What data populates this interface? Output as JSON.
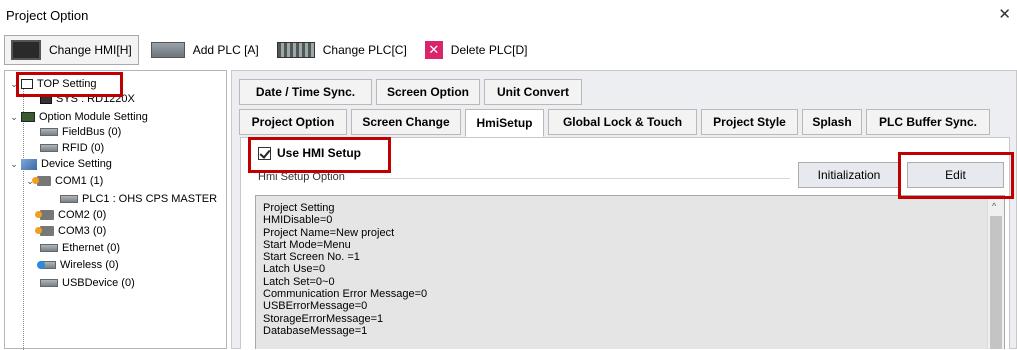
{
  "window": {
    "title": "Project Option",
    "close_glyph": "✕"
  },
  "toolbar": {
    "change_hmi": "Change HMI[H]",
    "add_plc": "Add PLC [A]",
    "change_plc": "Change PLC[C]",
    "delete_plc": "Delete PLC[D]",
    "delete_glyph": "✕"
  },
  "tree": {
    "top_setting": "TOP Setting",
    "sys": "SYS : RD1220X",
    "option_module": "Option Module Setting",
    "fieldbus": "FieldBus (0)",
    "rfid": "RFID (0)",
    "device_setting": "Device Setting",
    "com1": "COM1 (1)",
    "plc1": "PLC1 : OHS CPS MASTER",
    "com2": "COM2 (0)",
    "com3": "COM3 (0)",
    "ethernet": "Ethernet (0)",
    "wireless": "Wireless (0)",
    "usbdevice": "USBDevice (0)",
    "expanded_glyph": "⌄"
  },
  "tabs": {
    "row1": [
      "Date / Time Sync.",
      "Screen Option",
      "Unit Convert"
    ],
    "row2": [
      "Project Option",
      "Screen Change",
      "HmiSetup",
      "Global Lock & Touch",
      "Project Style",
      "Splash",
      "PLC Buffer Sync."
    ],
    "active": "HmiSetup"
  },
  "hmi_setup": {
    "use_label": "Use HMI Setup",
    "checked": true,
    "group_label": "Hmi Setup Option",
    "initialization_button": "Initialization",
    "edit_button": "Edit",
    "settings_lines": [
      "Project Setting",
      "HMIDisable=0",
      "Project Name=New project",
      "Start Mode=Menu",
      "Start Screen No. =1",
      "Latch Use=0",
      "Latch Set=0~0",
      "Communication Error Message=0",
      "USBErrorMessage=0",
      "StorageErrorMessage=1",
      "DatabaseMessage=1"
    ],
    "scroll_up_glyph": "^"
  },
  "colors": {
    "highlight": "#c00000",
    "panel_bg": "#eceef1",
    "textarea_bg": "#e5e5e5"
  },
  "icons": [
    "monitor-icon",
    "plc-icon",
    "plc-module-icon",
    "delete-icon",
    "project-node-icon",
    "system-icon",
    "option-module-icon",
    "device-icon",
    "com-port-icon",
    "plc-device-icon",
    "ethernet-icon",
    "wireless-icon",
    "usb-device-icon",
    "checkbox-checked-icon"
  ]
}
